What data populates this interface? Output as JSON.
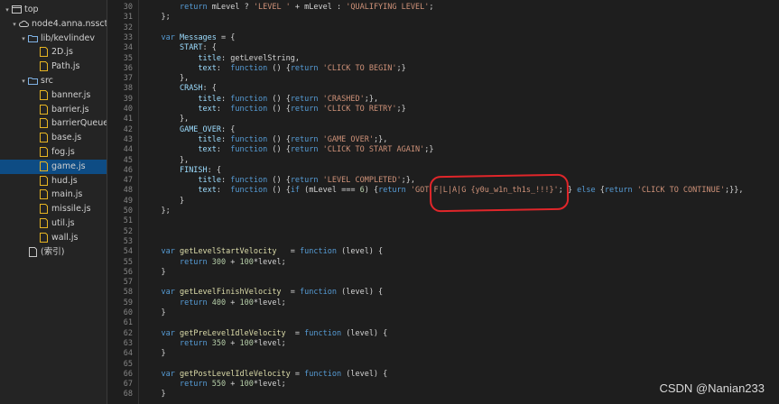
{
  "sidebar": {
    "items": [
      {
        "label": "top",
        "icon": "window-frame-icon",
        "twisty": "▾"
      },
      {
        "label": "node4.anna.nssctf.",
        "icon": "cloud-icon",
        "twisty": "▾"
      },
      {
        "label": "lib/kevlindev",
        "icon": "folder-icon",
        "twisty": "▾"
      },
      {
        "label": "2D.js",
        "icon": "js-file-icon"
      },
      {
        "label": "Path.js",
        "icon": "js-file-icon"
      },
      {
        "label": "src",
        "icon": "folder-icon",
        "twisty": "▾"
      },
      {
        "label": "banner.js",
        "icon": "js-file-icon"
      },
      {
        "label": "barrier.js",
        "icon": "js-file-icon"
      },
      {
        "label": "barrierQueue.j",
        "icon": "js-file-icon"
      },
      {
        "label": "base.js",
        "icon": "js-file-icon"
      },
      {
        "label": "fog.js",
        "icon": "js-file-icon"
      },
      {
        "label": "game.js",
        "icon": "js-file-icon",
        "selected": true
      },
      {
        "label": "hud.js",
        "icon": "js-file-icon"
      },
      {
        "label": "main.js",
        "icon": "js-file-icon"
      },
      {
        "label": "missile.js",
        "icon": "js-file-icon"
      },
      {
        "label": "util.js",
        "icon": "js-file-icon"
      },
      {
        "label": "wall.js",
        "icon": "js-file-icon"
      },
      {
        "label": "(索引)",
        "icon": "document-icon"
      }
    ]
  },
  "editor": {
    "lines": [
      {
        "n": "30",
        "t": [
          [
            "        ",
            ""
          ],
          [
            "return",
            "kw"
          ],
          [
            " mLevel ? ",
            ""
          ],
          [
            "'LEVEL '",
            "st"
          ],
          [
            " + mLevel : ",
            ""
          ],
          [
            "'QUALIFYING LEVEL'",
            "st"
          ],
          [
            ";",
            ""
          ]
        ]
      },
      {
        "n": "31",
        "t": [
          [
            "    };",
            ""
          ]
        ]
      },
      {
        "n": "32",
        "t": []
      },
      {
        "n": "33",
        "t": [
          [
            "    ",
            ""
          ],
          [
            "var",
            "kw"
          ],
          [
            " ",
            ""
          ],
          [
            "Messages",
            "vr"
          ],
          [
            " = {",
            ""
          ]
        ]
      },
      {
        "n": "34",
        "t": [
          [
            "        ",
            ""
          ],
          [
            "START",
            "pr"
          ],
          [
            ": {",
            ""
          ]
        ]
      },
      {
        "n": "35",
        "t": [
          [
            "            ",
            ""
          ],
          [
            "title",
            "pr"
          ],
          [
            ": getLevelString,",
            ""
          ]
        ]
      },
      {
        "n": "36",
        "t": [
          [
            "            ",
            ""
          ],
          [
            "text",
            "pr"
          ],
          [
            ":  ",
            ""
          ],
          [
            "function",
            "kw"
          ],
          [
            " () {",
            ""
          ],
          [
            "return",
            "kw"
          ],
          [
            " ",
            ""
          ],
          [
            "'CLICK TO BEGIN'",
            "st"
          ],
          [
            ";}",
            ""
          ]
        ]
      },
      {
        "n": "37",
        "t": [
          [
            "        },",
            ""
          ]
        ]
      },
      {
        "n": "38",
        "t": [
          [
            "        ",
            ""
          ],
          [
            "CRASH",
            "pr"
          ],
          [
            ": {",
            ""
          ]
        ]
      },
      {
        "n": "39",
        "t": [
          [
            "            ",
            ""
          ],
          [
            "title",
            "pr"
          ],
          [
            ": ",
            ""
          ],
          [
            "function",
            "kw"
          ],
          [
            " () {",
            ""
          ],
          [
            "return",
            "kw"
          ],
          [
            " ",
            ""
          ],
          [
            "'CRASHED'",
            "st"
          ],
          [
            ";},",
            ""
          ]
        ]
      },
      {
        "n": "40",
        "t": [
          [
            "            ",
            ""
          ],
          [
            "text",
            "pr"
          ],
          [
            ":  ",
            ""
          ],
          [
            "function",
            "kw"
          ],
          [
            " () {",
            ""
          ],
          [
            "return",
            "kw"
          ],
          [
            " ",
            ""
          ],
          [
            "'CLICK TO RETRY'",
            "st"
          ],
          [
            ";}",
            ""
          ]
        ]
      },
      {
        "n": "41",
        "t": [
          [
            "        },",
            ""
          ]
        ]
      },
      {
        "n": "42",
        "t": [
          [
            "        ",
            ""
          ],
          [
            "GAME_OVER",
            "pr"
          ],
          [
            ": {",
            ""
          ]
        ]
      },
      {
        "n": "43",
        "t": [
          [
            "            ",
            ""
          ],
          [
            "title",
            "pr"
          ],
          [
            ": ",
            ""
          ],
          [
            "function",
            "kw"
          ],
          [
            " () {",
            ""
          ],
          [
            "return",
            "kw"
          ],
          [
            " ",
            ""
          ],
          [
            "'GAME OVER'",
            "st"
          ],
          [
            ";},",
            ""
          ]
        ]
      },
      {
        "n": "44",
        "t": [
          [
            "            ",
            ""
          ],
          [
            "text",
            "pr"
          ],
          [
            ":  ",
            ""
          ],
          [
            "function",
            "kw"
          ],
          [
            " () {",
            ""
          ],
          [
            "return",
            "kw"
          ],
          [
            " ",
            ""
          ],
          [
            "'CLICK TO START AGAIN'",
            "st"
          ],
          [
            ";}",
            ""
          ]
        ]
      },
      {
        "n": "45",
        "t": [
          [
            "        },",
            ""
          ]
        ]
      },
      {
        "n": "46",
        "t": [
          [
            "        ",
            ""
          ],
          [
            "FINISH",
            "pr"
          ],
          [
            ": {",
            ""
          ]
        ]
      },
      {
        "n": "47",
        "t": [
          [
            "            ",
            ""
          ],
          [
            "title",
            "pr"
          ],
          [
            ": ",
            ""
          ],
          [
            "function",
            "kw"
          ],
          [
            " () {",
            ""
          ],
          [
            "return",
            "kw"
          ],
          [
            " ",
            ""
          ],
          [
            "'LEVEL COMPLETED'",
            "st"
          ],
          [
            ";},",
            ""
          ]
        ]
      },
      {
        "n": "48",
        "t": [
          [
            "            ",
            ""
          ],
          [
            "text",
            "pr"
          ],
          [
            ":  ",
            ""
          ],
          [
            "function",
            "kw"
          ],
          [
            " () {",
            ""
          ],
          [
            "if",
            "kw"
          ],
          [
            " (mLevel === ",
            ""
          ],
          [
            "6",
            "nm"
          ],
          [
            ") {",
            ""
          ],
          [
            "return",
            "kw"
          ],
          [
            " ",
            ""
          ],
          [
            "'GOT F|L|A|G {y0u_w1n_th1s_!!!}'",
            "st"
          ],
          [
            "; } ",
            ""
          ],
          [
            "else",
            "kw"
          ],
          [
            " {",
            ""
          ],
          [
            "return",
            "kw"
          ],
          [
            " ",
            ""
          ],
          [
            "'CLICK TO CONTINUE'",
            "st"
          ],
          [
            ";}},",
            ""
          ]
        ]
      },
      {
        "n": "49",
        "t": [
          [
            "        }",
            ""
          ]
        ]
      },
      {
        "n": "50",
        "t": [
          [
            "    };",
            ""
          ]
        ]
      },
      {
        "n": "51",
        "t": []
      },
      {
        "n": "52",
        "t": []
      },
      {
        "n": "53",
        "t": []
      },
      {
        "n": "54",
        "t": [
          [
            "    ",
            ""
          ],
          [
            "var",
            "kw"
          ],
          [
            " ",
            ""
          ],
          [
            "getLevelStartVelocity",
            "fn"
          ],
          [
            "   = ",
            ""
          ],
          [
            "function",
            "kw"
          ],
          [
            " (level) {",
            ""
          ]
        ]
      },
      {
        "n": "55",
        "t": [
          [
            "        ",
            ""
          ],
          [
            "return",
            "kw"
          ],
          [
            " ",
            ""
          ],
          [
            "300",
            "nm"
          ],
          [
            " + ",
            ""
          ],
          [
            "100",
            "nm"
          ],
          [
            "*level;",
            ""
          ]
        ]
      },
      {
        "n": "56",
        "t": [
          [
            "    }",
            ""
          ]
        ]
      },
      {
        "n": "57",
        "t": []
      },
      {
        "n": "58",
        "t": [
          [
            "    ",
            ""
          ],
          [
            "var",
            "kw"
          ],
          [
            " ",
            ""
          ],
          [
            "getLevelFinishVelocity",
            "fn"
          ],
          [
            "  = ",
            ""
          ],
          [
            "function",
            "kw"
          ],
          [
            " (level) {",
            ""
          ]
        ]
      },
      {
        "n": "59",
        "t": [
          [
            "        ",
            ""
          ],
          [
            "return",
            "kw"
          ],
          [
            " ",
            ""
          ],
          [
            "400",
            "nm"
          ],
          [
            " + ",
            ""
          ],
          [
            "100",
            "nm"
          ],
          [
            "*level;",
            ""
          ]
        ]
      },
      {
        "n": "60",
        "t": [
          [
            "    }",
            ""
          ]
        ]
      },
      {
        "n": "61",
        "t": []
      },
      {
        "n": "62",
        "t": [
          [
            "    ",
            ""
          ],
          [
            "var",
            "kw"
          ],
          [
            " ",
            ""
          ],
          [
            "getPreLevelIdleVelocity",
            "fn"
          ],
          [
            "  = ",
            ""
          ],
          [
            "function",
            "kw"
          ],
          [
            " (level) {",
            ""
          ]
        ]
      },
      {
        "n": "63",
        "t": [
          [
            "        ",
            ""
          ],
          [
            "return",
            "kw"
          ],
          [
            " ",
            ""
          ],
          [
            "350",
            "nm"
          ],
          [
            " + ",
            ""
          ],
          [
            "100",
            "nm"
          ],
          [
            "*level;",
            ""
          ]
        ]
      },
      {
        "n": "64",
        "t": [
          [
            "    }",
            ""
          ]
        ]
      },
      {
        "n": "65",
        "t": []
      },
      {
        "n": "66",
        "t": [
          [
            "    ",
            ""
          ],
          [
            "var",
            "kw"
          ],
          [
            " ",
            ""
          ],
          [
            "getPostLevelIdleVelocity",
            "fn"
          ],
          [
            " = ",
            ""
          ],
          [
            "function",
            "kw"
          ],
          [
            " (level) {",
            ""
          ]
        ]
      },
      {
        "n": "67",
        "t": [
          [
            "        ",
            ""
          ],
          [
            "return",
            "kw"
          ],
          [
            " ",
            ""
          ],
          [
            "550",
            "nm"
          ],
          [
            " + ",
            ""
          ],
          [
            "100",
            "nm"
          ],
          [
            "*level;",
            ""
          ]
        ]
      },
      {
        "n": "68",
        "t": [
          [
            "    }",
            ""
          ]
        ]
      }
    ]
  },
  "watermark": "CSDN @Nanian233",
  "colors": {
    "keyword": "#569cd6",
    "string": "#ce9178",
    "number": "#b5cea8",
    "function": "#dcdcaa",
    "selection": "#0e4c84",
    "annotation": "#e0262a"
  }
}
